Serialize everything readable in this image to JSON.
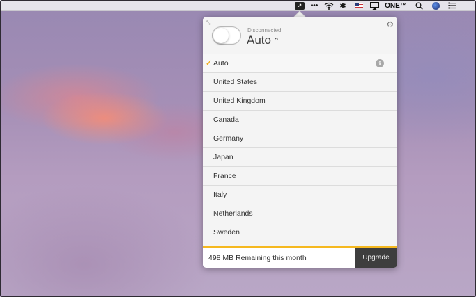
{
  "menubar": {
    "vpn_icon_glyph": "↗",
    "dots_glyph": "•••",
    "wifi_glyph": "⌔",
    "bluetooth_glyph": "✱",
    "airplay_glyph": "▭",
    "one_label": "ONE™",
    "search_glyph": "⚲",
    "list_glyph": "☰"
  },
  "vpn": {
    "status": "Disconnected",
    "selected_location": "Auto",
    "connected": false,
    "locations": [
      {
        "label": "Auto",
        "selected": true,
        "info": true
      },
      {
        "label": "United States"
      },
      {
        "label": "United Kingdom"
      },
      {
        "label": "Canada"
      },
      {
        "label": "Germany"
      },
      {
        "label": "Japan"
      },
      {
        "label": "France"
      },
      {
        "label": "Italy"
      },
      {
        "label": "Netherlands"
      },
      {
        "label": "Sweden"
      }
    ],
    "check_glyph": "✓",
    "info_glyph": "i",
    "settings_glyph": "⚙",
    "collapse_glyph": "⤡",
    "chevron_glyph": "⌃"
  },
  "footer": {
    "remaining_text": "498 MB Remaining this month",
    "upgrade_label": "Upgrade",
    "accent_color": "#f5b81f"
  }
}
